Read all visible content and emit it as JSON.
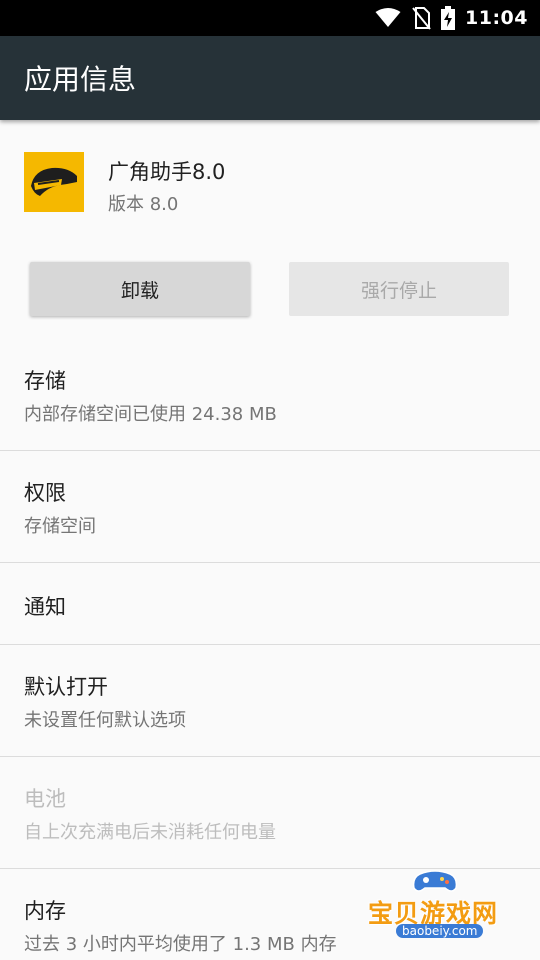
{
  "status_bar": {
    "time": "11:04",
    "icons": [
      "wifi-icon",
      "no-sim-icon",
      "battery-charging-icon"
    ]
  },
  "app_bar": {
    "title": "应用信息"
  },
  "app": {
    "name": "广角助手8.0",
    "version": "版本 8.0",
    "icon": "helmet-icon"
  },
  "buttons": {
    "uninstall": "卸载",
    "force_stop": "强行停止"
  },
  "prefs": [
    {
      "title": "存储",
      "summary": "内部存储空间已使用 24.38 MB"
    },
    {
      "title": "权限",
      "summary": "存储空间"
    },
    {
      "title": "通知",
      "summary": ""
    },
    {
      "title": "默认打开",
      "summary": "未设置任何默认选项"
    },
    {
      "title": "电池",
      "summary": "自上次充满电后未消耗任何电量"
    },
    {
      "title": "内存",
      "summary": "过去 3 小时内平均使用了 1.3 MB 内存"
    }
  ],
  "watermark": {
    "text": "宝贝游戏网",
    "url": "baobeiy.com"
  },
  "colors": {
    "app_bar": "#263238",
    "status_bar": "#000000",
    "background": "#fafafa",
    "icon_bg": "#f5b800"
  }
}
